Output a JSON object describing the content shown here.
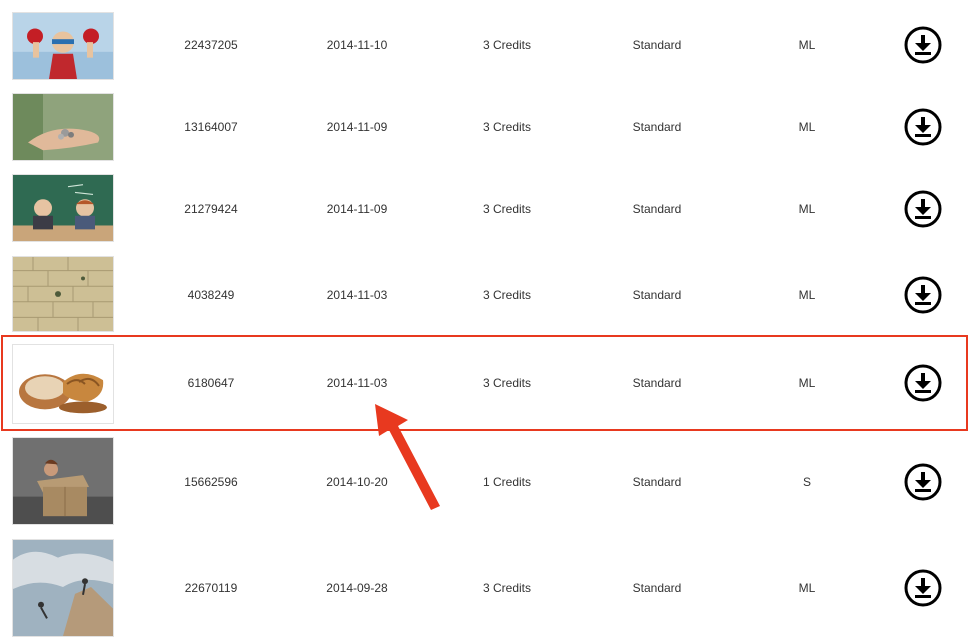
{
  "rows": [
    {
      "id": "22437205",
      "date": "2014-11-10",
      "credits": "3 Credits",
      "license": "Standard",
      "size": "ML",
      "thumb": "superhero-child"
    },
    {
      "id": "13164007",
      "date": "2014-11-09",
      "credits": "3 Credits",
      "license": "Standard",
      "size": "ML",
      "thumb": "hand-with-coins"
    },
    {
      "id": "21279424",
      "date": "2014-11-09",
      "credits": "3 Credits",
      "license": "Standard",
      "size": "ML",
      "thumb": "kids-at-chalkboard"
    },
    {
      "id": "4038249",
      "date": "2014-11-03",
      "credits": "3 Credits",
      "license": "Standard",
      "size": "ML",
      "thumb": "stone-wall"
    },
    {
      "id": "6180647",
      "date": "2014-11-03",
      "credits": "3 Credits",
      "license": "Standard",
      "size": "ML",
      "thumb": "walnut-shell"
    },
    {
      "id": "15662596",
      "date": "2014-10-20",
      "credits": "1 Credits",
      "license": "Standard",
      "size": "S",
      "thumb": "person-in-box"
    },
    {
      "id": "22670119",
      "date": "2014-09-28",
      "credits": "3 Credits",
      "license": "Standard",
      "size": "ML",
      "thumb": "climbers-on-cliff"
    }
  ],
  "icons": {
    "download": "download-circle-icon"
  },
  "annotation": {
    "highlight_color": "#e8391f",
    "highlighted_row_id": "6180647"
  }
}
